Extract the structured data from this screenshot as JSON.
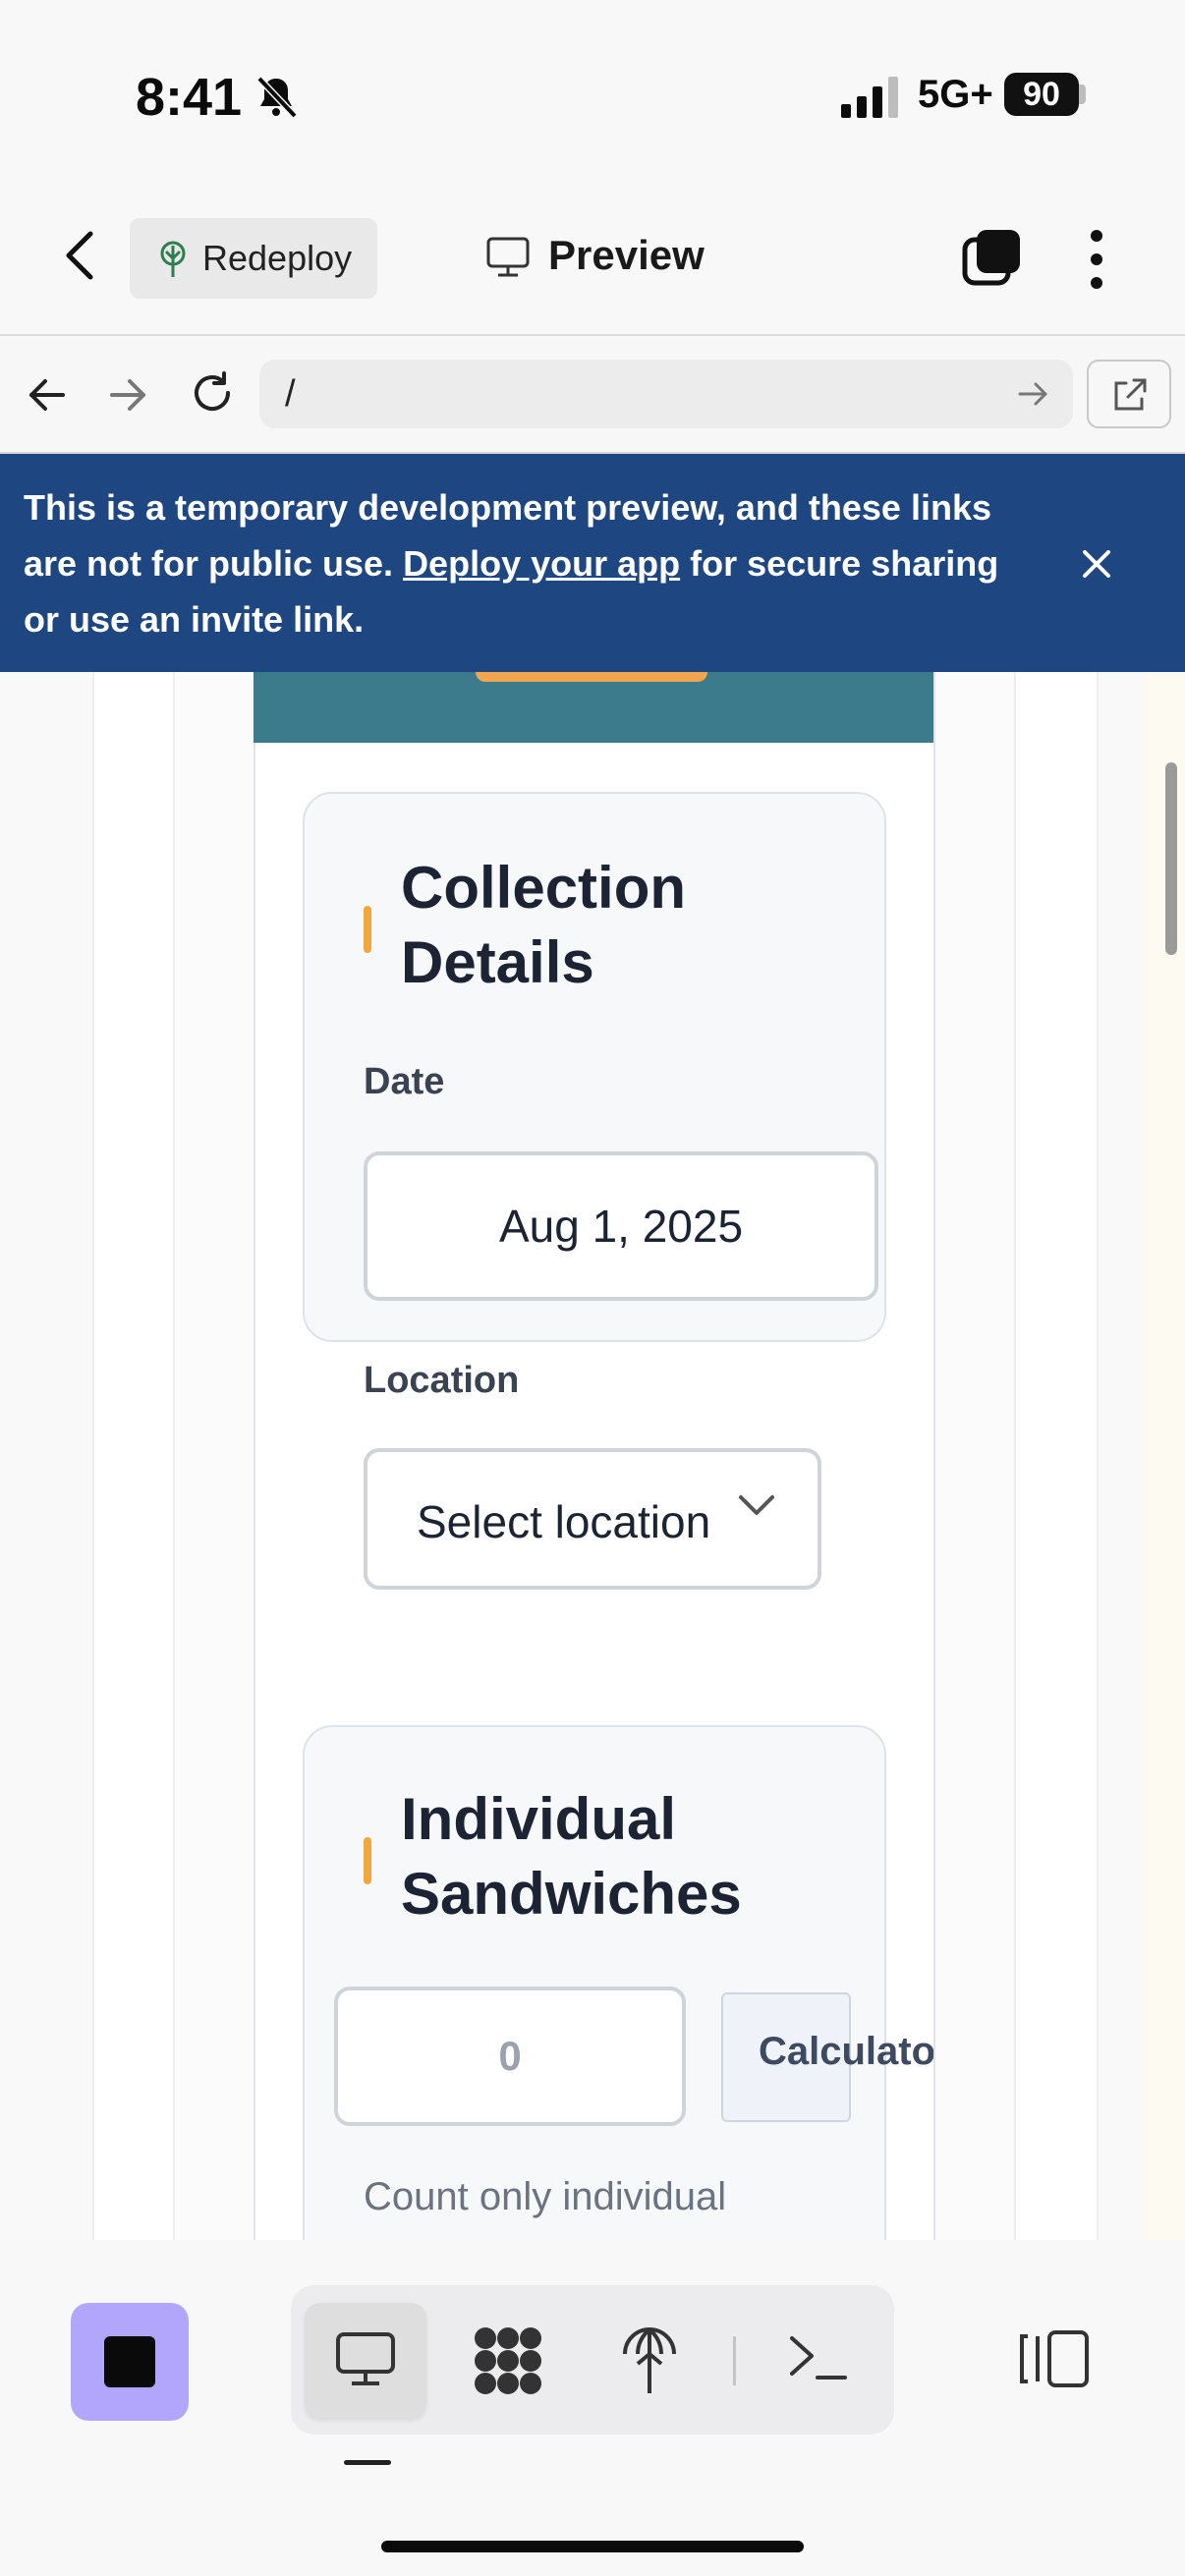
{
  "status_bar": {
    "time": "8:41",
    "network": "5G+",
    "battery": "90"
  },
  "header": {
    "redeploy_label": "Redeploy",
    "preview_label": "Preview"
  },
  "url_bar": {
    "url": "/"
  },
  "banner": {
    "text_before": "This is a temporary development preview, and these links are not for public use. ",
    "link_text": "Deploy your app",
    "text_after": " for secure sharing or use an invite link."
  },
  "collection_details": {
    "title": "Collection Details",
    "date_label": "Date",
    "date_value": "Aug 1, 2025",
    "location_label": "Location",
    "location_value": "Select location"
  },
  "individual_sandwiches": {
    "title": "Individual Sandwiches",
    "count_value": "0",
    "calculator_label": "Calculato",
    "helper_text": "Count only individual"
  },
  "icons": {
    "bell": "bell-slash-icon",
    "back": "chevron-left-icon",
    "tree": "tree-icon",
    "monitor": "monitor-icon",
    "tabs": "tabs-icon",
    "more": "more-vertical-icon",
    "close": "close-icon",
    "open_external": "external-link-icon"
  },
  "colors": {
    "banner_bg": "#1e4680",
    "accent": "#f1a73d",
    "stop_button": "#b1a6fb"
  }
}
